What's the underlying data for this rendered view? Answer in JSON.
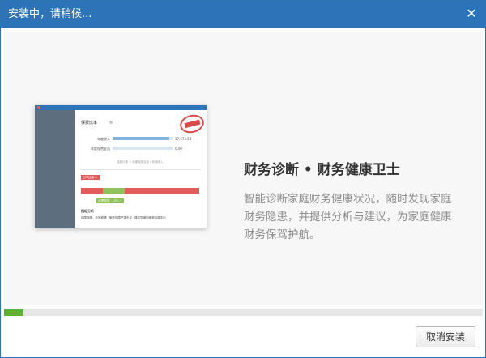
{
  "window": {
    "title": "安装中，请稍候...",
    "close_icon": "close-icon",
    "accent_color": "#2c73b7"
  },
  "preview": {
    "title": "保费比率",
    "rows": [
      {
        "label": "年度收入",
        "value": "17,575.54",
        "fill": 0.95
      },
      {
        "label": "年度保费支出",
        "value": "0.00",
        "fill": 0.0
      }
    ],
    "note": "保费比率 = 年度保费支出 / 年度收入",
    "red_tag": "比率过高 > 15%",
    "green_tag": "合理范围：10% ~ 15%",
    "analysis_title": "指标分析",
    "analysis_text": "保障程度：非常稳健 · 家庭保障严重不足 · 建议您增加家庭保费支出"
  },
  "feature": {
    "heading": "财务诊断 • 财务健康卫士",
    "description": "智能诊断家庭财务健康状况，随时发现家庭财务隐患，并提供分析与建议，为家庭健康财务保驾护航。"
  },
  "progress": {
    "value": 0.04,
    "color": "#5ab134"
  },
  "footer": {
    "cancel_label": "取消安装"
  }
}
